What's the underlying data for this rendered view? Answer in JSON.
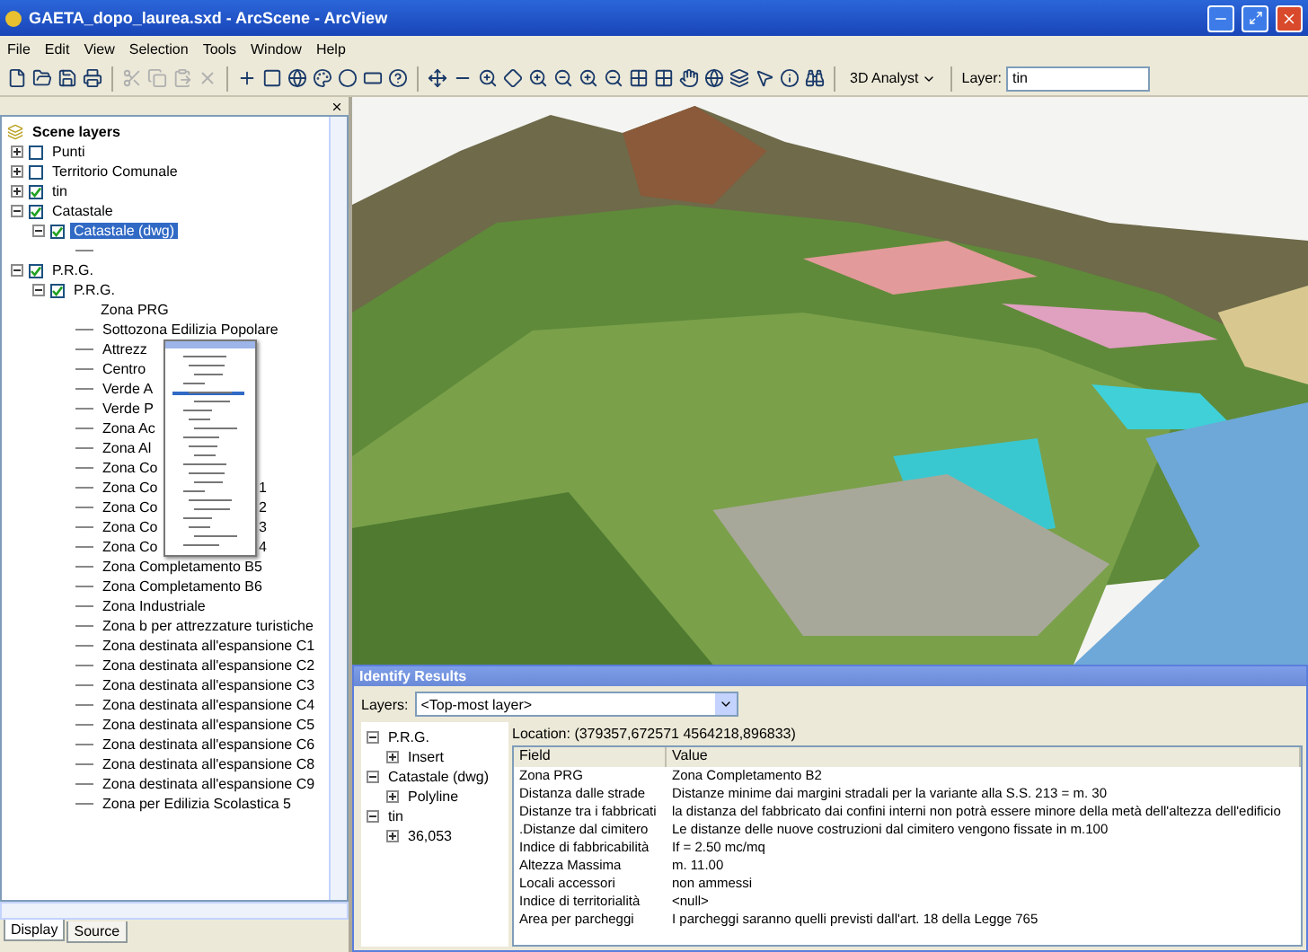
{
  "window": {
    "title": "GAETA_dopo_laurea.sxd - ArcScene - ArcView"
  },
  "menu": [
    "File",
    "Edit",
    "View",
    "Selection",
    "Tools",
    "Window",
    "Help"
  ],
  "toolbar": {
    "dropdown": "3D Analyst",
    "layer_label": "Layer:",
    "layer_value": "tin"
  },
  "toc": {
    "root": "Scene layers",
    "layers": [
      {
        "label": "Punti",
        "checked": false,
        "expanded": false,
        "selected": false
      },
      {
        "label": "Territorio Comunale",
        "checked": false,
        "expanded": false,
        "selected": false
      },
      {
        "label": "tin",
        "checked": true,
        "expanded": false,
        "selected": false
      },
      {
        "label": "Catastale",
        "checked": true,
        "expanded": true,
        "selected": false,
        "children": [
          {
            "label": "Catastale (dwg)",
            "checked": true,
            "expanded": true,
            "selected": true,
            "legend": [
              {
                "kind": "symbol"
              }
            ]
          }
        ]
      },
      {
        "label": "P.R.G.",
        "checked": true,
        "expanded": true,
        "selected": false,
        "children": [
          {
            "label": "P.R.G.",
            "checked": true,
            "expanded": true,
            "selected": false,
            "legend": [
              {
                "kind": "heading",
                "label": "Zona PRG"
              },
              {
                "kind": "class",
                "label": "Sottozona Edilizia Popolare"
              },
              {
                "kind": "class",
                "label": "Attrezz"
              },
              {
                "kind": "class",
                "label": "Centro"
              },
              {
                "kind": "class",
                "label": "Verde A"
              },
              {
                "kind": "class",
                "label": "Verde P"
              },
              {
                "kind": "class",
                "label": "Zona Ac"
              },
              {
                "kind": "class",
                "label": "Zona Al"
              },
              {
                "kind": "class",
                "label": "Zona Co"
              },
              {
                "kind": "class",
                "label": "Zona Co",
                "tail": "1"
              },
              {
                "kind": "class",
                "label": "Zona Co",
                "tail": "2"
              },
              {
                "kind": "class",
                "label": "Zona Co",
                "tail": "3"
              },
              {
                "kind": "class",
                "label": "Zona Co",
                "tail": "4"
              },
              {
                "kind": "class",
                "label": "Zona Completamento B5"
              },
              {
                "kind": "class",
                "label": "Zona Completamento B6"
              },
              {
                "kind": "class",
                "label": "Zona Industriale"
              },
              {
                "kind": "class",
                "label": "Zona b per attrezzature turistiche"
              },
              {
                "kind": "class",
                "label": "Zona destinata all'espansione C1"
              },
              {
                "kind": "class",
                "label": "Zona destinata all'espansione C2"
              },
              {
                "kind": "class",
                "label": "Zona destinata all'espansione C3"
              },
              {
                "kind": "class",
                "label": "Zona destinata all'espansione C4"
              },
              {
                "kind": "class",
                "label": "Zona destinata all'espansione C5"
              },
              {
                "kind": "class",
                "label": "Zona destinata all'espansione C6"
              },
              {
                "kind": "class",
                "label": "Zona destinata all'espansione C8"
              },
              {
                "kind": "class",
                "label": "Zona destinata all'espansione C9"
              },
              {
                "kind": "class",
                "label": "Zona per Edilizia Scolastica 5"
              }
            ]
          }
        ]
      }
    ]
  },
  "tabs": [
    {
      "label": "Display",
      "selected": true
    },
    {
      "label": "Source",
      "selected": false
    }
  ],
  "identify": {
    "title": "Identify Results",
    "layers_label": "Layers:",
    "layers_value": "<Top-most layer>",
    "tree": [
      {
        "label": "P.R.G.",
        "children": [
          "Insert"
        ]
      },
      {
        "label": "Catastale (dwg)",
        "children": [
          "Polyline"
        ]
      },
      {
        "label": "tin",
        "children": [
          "36,053"
        ]
      }
    ],
    "location": "Location: (379357,672571 4564218,896833)",
    "columns": [
      "Field",
      "Value"
    ],
    "rows": [
      [
        "Zona PRG",
        "Zona Completamento B2"
      ],
      [
        "Distanza dalle strade",
        "Distanze minime dai margini stradali per la variante alla S.S. 213 = m. 30"
      ],
      [
        "Distanze tra i fabbricati",
        "la distanza del fabbricato dai confini interni non potrà essere minore della metà dell'altezza dell'edificio"
      ],
      [
        ".Distanze dal cimitero",
        "Le distanze delle nuove costruzioni dal cimitero vengono fissate in m.100"
      ],
      [
        "Indice di fabbricabilità",
        "If = 2.50 mc/mq"
      ],
      [
        "Altezza Massima",
        "m. 11.00"
      ],
      [
        "Locali accessori",
        "non ammessi"
      ],
      [
        "Indice di territorialità",
        "<null>"
      ],
      [
        "Area per parcheggi",
        "I parcheggi saranno quelli previsti dall'art. 18 della Legge 765"
      ]
    ]
  }
}
